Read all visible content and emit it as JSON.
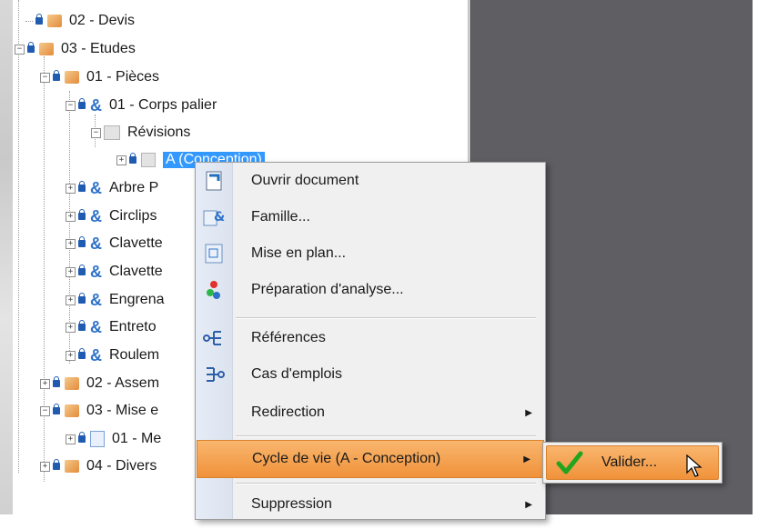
{
  "tree": {
    "rows": [
      {
        "label": "02 - Devis",
        "icon": "folder-icon"
      },
      {
        "label": "03 - Etudes",
        "icon": "folder-icon"
      },
      {
        "label": "01 - Pièces",
        "icon": "folder-icon"
      },
      {
        "label": "01 - Corps palier",
        "icon": "part-icon"
      },
      {
        "label": "Révisions",
        "icon": "revisions-icon"
      },
      {
        "label": "A (Conception)",
        "icon": "revision-item-icon"
      },
      {
        "label": "Arbre P",
        "icon": "part-icon"
      },
      {
        "label": "Circlips",
        "icon": "part-icon"
      },
      {
        "label": "Clavette",
        "icon": "part-icon"
      },
      {
        "label": "Clavette",
        "icon": "part-icon"
      },
      {
        "label": "Engrena",
        "icon": "part-icon"
      },
      {
        "label": "Entreto",
        "icon": "part-icon"
      },
      {
        "label": "Roulem",
        "icon": "part-icon"
      },
      {
        "label": "02 - Assem",
        "icon": "folder-icon"
      },
      {
        "label": "03 - Mise e",
        "icon": "folder-icon"
      },
      {
        "label": "01 - Me",
        "icon": "drawing-icon"
      },
      {
        "label": "04 - Divers",
        "icon": "folder-icon"
      }
    ]
  },
  "context_menu": {
    "items": [
      {
        "label": "Ouvrir document",
        "icon": "open-document-icon"
      },
      {
        "label": "Famille...",
        "icon": "family-icon"
      },
      {
        "label": "Mise en plan...",
        "icon": "drawing-icon"
      },
      {
        "label": "Préparation d'analyse...",
        "icon": "analysis-icon"
      },
      {
        "label": "Références",
        "icon": "references-icon"
      },
      {
        "label": "Cas d'emplois",
        "icon": "where-used-icon"
      },
      {
        "label": "Redirection",
        "icon": ""
      },
      {
        "label": "Cycle de vie (A - Conception)",
        "icon": ""
      },
      {
        "label": "Suppression",
        "icon": ""
      }
    ]
  },
  "submenu": {
    "items": [
      {
        "label": "Valider...",
        "icon": "check-icon"
      }
    ]
  },
  "colors": {
    "highlight": "#f0923a",
    "selection": "#3399ff",
    "right_pane": "#5e5e63"
  }
}
